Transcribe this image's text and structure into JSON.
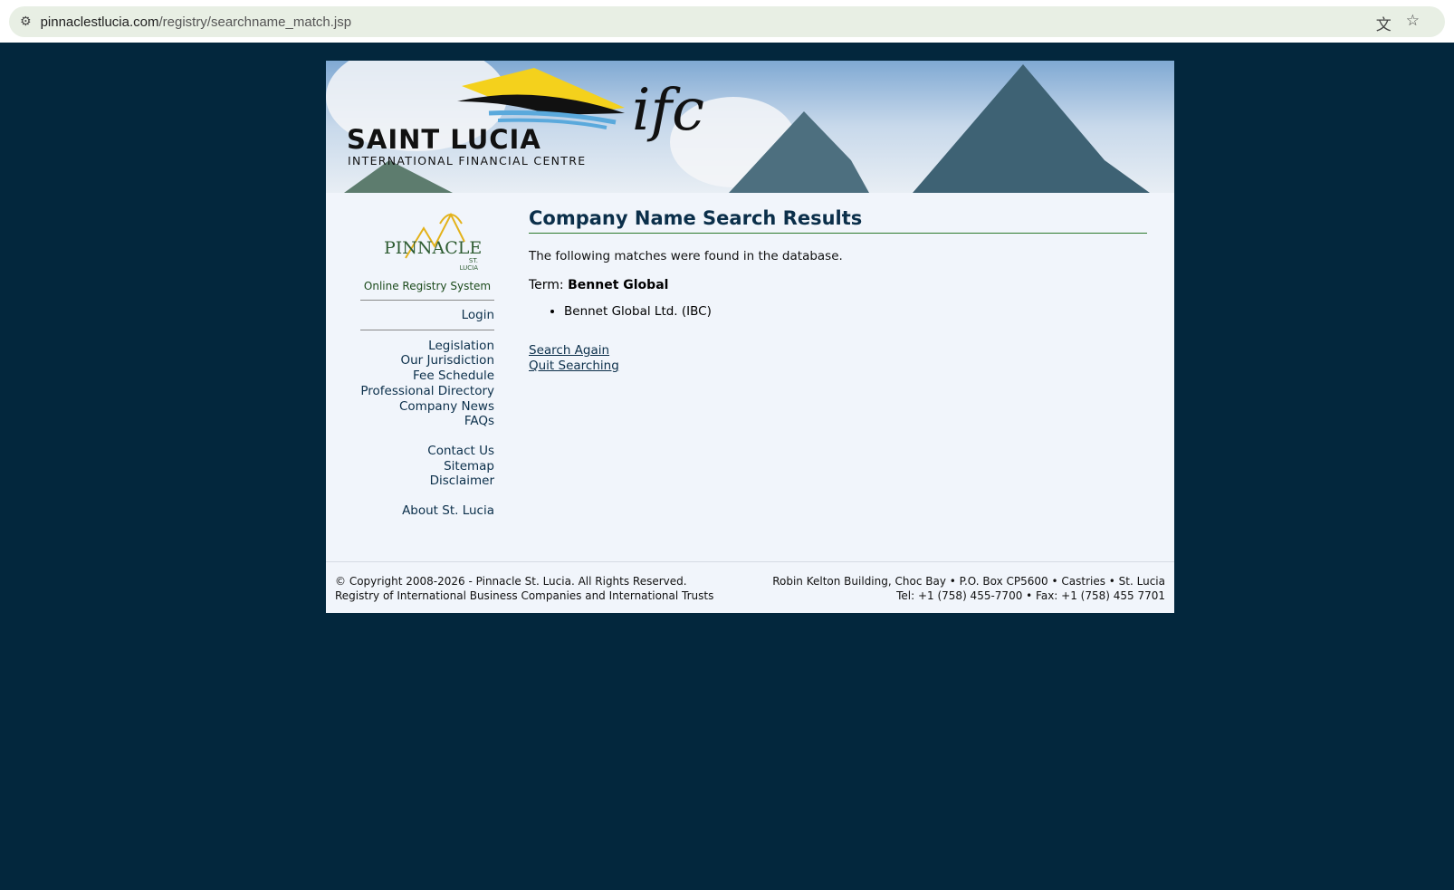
{
  "browser": {
    "url_domain": "pinnaclestlucia.com",
    "url_path": "/registry/searchname_match.jsp"
  },
  "banner": {
    "title": "SAINT LUCIA",
    "subtitle": "INTERNATIONAL FINANCIAL CENTRE",
    "mark": "ifc"
  },
  "sidebar": {
    "logo": "PINNACLE",
    "logo_sub": "ST. LUCIA",
    "system": "Online Registry System",
    "login": "Login",
    "group1": [
      "Legislation",
      "Our Jurisdiction",
      "Fee Schedule",
      "Professional Directory",
      "Company News",
      "FAQs"
    ],
    "group2": [
      "Contact Us",
      "Sitemap",
      "Disclaimer"
    ],
    "group3": [
      "About St. Lucia"
    ]
  },
  "main": {
    "title": "Company Name Search Results",
    "intro": "The following matches were found in the database.",
    "term_label": "Term:",
    "term": "Bennet Global",
    "results": [
      "Bennet Global Ltd. (IBC)"
    ],
    "search_again": "Search Again",
    "quit": "Quit Searching"
  },
  "footer": {
    "copyright": "© Copyright 2008-2026 - Pinnacle St. Lucia. All Rights Reserved.",
    "registry": "Registry of International Business Companies and International Trusts",
    "address": "Robin Kelton Building, Choc Bay • P.O. Box CP5600 • Castries • St. Lucia",
    "phone": "Tel: +1 (758) 455-7700 • Fax: +1 (758) 455 7701"
  }
}
